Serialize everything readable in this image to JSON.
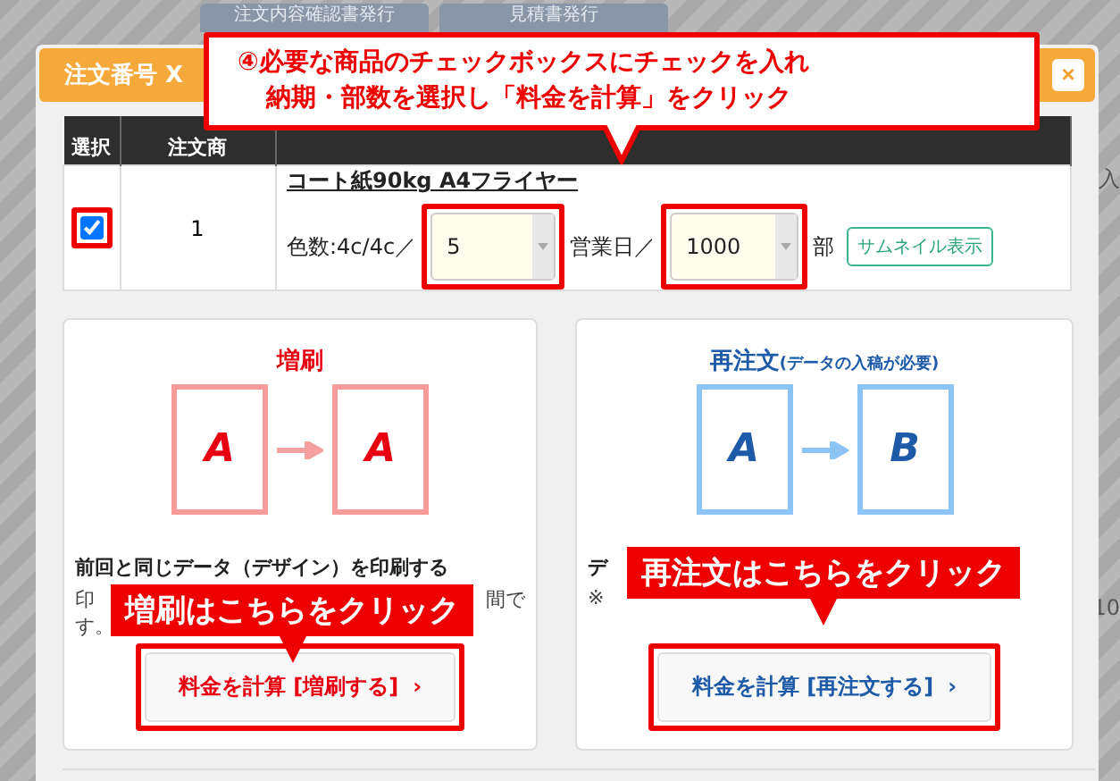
{
  "background_buttons": [
    "注文内容確認書発行",
    "見積書発行"
  ],
  "page_fragments": [
    "入",
    "10"
  ],
  "modal": {
    "title": "注文番号 X",
    "close": "×"
  },
  "table": {
    "columns": [
      "選択",
      "注文商"
    ],
    "rows": [
      {
        "selected": true,
        "number": "1",
        "product": "コート紙90kg A4フライヤー",
        "colors": "色数:4c/4c／",
        "days": "5",
        "days_unit": "営業日／",
        "quantity": "1000",
        "quantity_unit": "部",
        "thumbnail_button": "サムネイル表示"
      }
    ]
  },
  "options": [
    {
      "kind": "reprint",
      "title": "増刷",
      "pages": [
        "A",
        "A"
      ],
      "heading": "前回と同じデータ（デザイン）を印刷する",
      "note": [
        "印",
        "間で",
        "す。"
      ],
      "button": "料金を計算 [増刷する]",
      "chevron": "›",
      "callout": "増刷はこちらをクリック"
    },
    {
      "kind": "reorder",
      "title": "再注文",
      "subtitle": "(データの入稿が必要)",
      "pages": [
        "A",
        "B"
      ],
      "heading": "デ",
      "note": [
        "※"
      ],
      "button": "料金を計算 [再注文する]",
      "chevron": "›",
      "callout": "再注文はこちらをクリック"
    }
  ],
  "callout": {
    "number": "④",
    "lines": [
      "必要な商品のチェックボックスにチェックを入れ",
      "納期・部数を選択し「料金を計算」をクリック"
    ]
  }
}
